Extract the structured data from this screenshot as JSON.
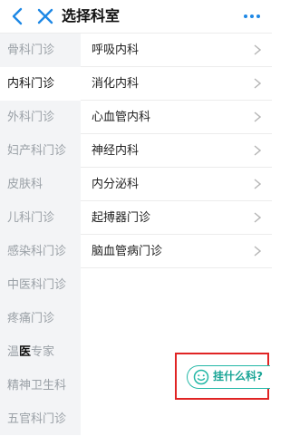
{
  "header": {
    "title": "选择科室",
    "back_icon": "chevron-left-icon",
    "close_icon": "close-icon",
    "more_icon": "more-horizontal-icon",
    "accent_color": "#1e88e5"
  },
  "sidebar": {
    "items": [
      {
        "label": "骨科门诊",
        "active": false
      },
      {
        "label": "内科门诊",
        "active": true
      },
      {
        "label": "外科门诊",
        "active": false
      },
      {
        "label": "妇产科门诊",
        "active": false
      },
      {
        "label": "皮肤科",
        "active": false
      },
      {
        "label": "儿科门诊",
        "active": false
      },
      {
        "label": "感染科门诊",
        "active": false
      },
      {
        "label": "中医科门诊",
        "active": false
      },
      {
        "label": "疼痛门诊",
        "active": false
      },
      {
        "label_pre": "温",
        "label_hl": "医",
        "label_post": "专家",
        "active": false
      },
      {
        "label": "精神卫生科",
        "active": false
      },
      {
        "label": "五官科门诊",
        "active": false
      }
    ]
  },
  "departments": [
    {
      "label": "呼吸内科"
    },
    {
      "label": "消化内科"
    },
    {
      "label": "心血管内科"
    },
    {
      "label": "神经内科"
    },
    {
      "label": "内分泌科"
    },
    {
      "label": "起搏器门诊"
    },
    {
      "label": "脑血管病门诊"
    }
  ],
  "float_button": {
    "label": "挂什么科?",
    "icon": "smile-face-icon",
    "color": "#23b7a6"
  }
}
